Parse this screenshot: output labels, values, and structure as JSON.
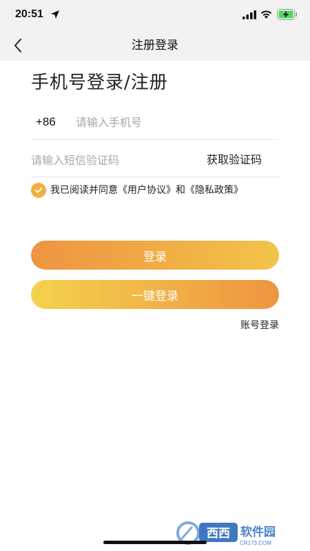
{
  "status_bar": {
    "time": "20:51"
  },
  "nav": {
    "title": "注册登录"
  },
  "login": {
    "heading": "手机号登录/注册",
    "country_code": "+86",
    "phone_placeholder": "请输入手机号",
    "code_placeholder": "请输入短信验证码",
    "get_code_label": "获取验证码",
    "agreement_text": "我已阅读并同意《用户协议》和《隐私政策》",
    "login_button": "登录",
    "one_click_button": "一键登录",
    "account_login": "账号登录"
  },
  "colors": {
    "accent_orange": "#ee9440",
    "accent_yellow": "#f4d24e",
    "checkbox": "#f2ae42"
  },
  "watermark": {
    "text": "西西软件园",
    "url_text": "CR173.COM"
  }
}
